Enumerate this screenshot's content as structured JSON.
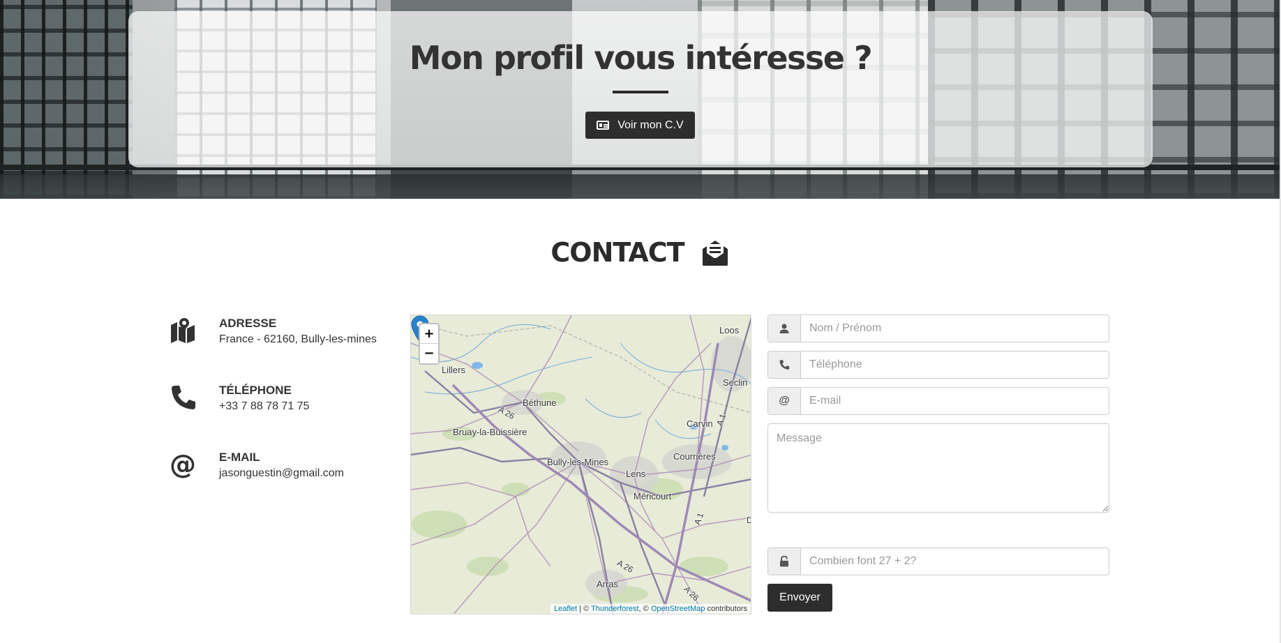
{
  "hero": {
    "title": "Mon profil vous intéresse ?",
    "cv_button_label": "Voir mon C.V",
    "cv_button_icon": "id-card-icon"
  },
  "contact": {
    "title": "CONTACT",
    "title_icon": "envelope-open-text-icon",
    "items": [
      {
        "icon": "map-icon",
        "label": "ADRESSE",
        "value": "France - 62160, Bully-les-mines"
      },
      {
        "icon": "phone-icon",
        "label": "TÉLÉPHONE",
        "value": "+33 7 88 78 71 75"
      },
      {
        "icon": "at-icon",
        "label": "E-MAIL",
        "value": "jasonguestin@gmail.com"
      }
    ]
  },
  "map": {
    "zoom_in": "+",
    "zoom_out": "−",
    "marker_label": "Bully-les-Mines",
    "labels": [
      "Loos",
      "Lillers",
      "Seclin",
      "Béthune",
      "Carvin",
      "Bruay-la-Buissière",
      "Courrières",
      "Lens",
      "Méricourt",
      "Arras",
      "D",
      "A 26",
      "A 1"
    ],
    "attribution": {
      "leaflet": "Leaflet",
      "sep1": " | © ",
      "thunderforest": "Thunderforest",
      "sep2": ", © ",
      "osm": "OpenStreetMap",
      "tail": " contributors"
    }
  },
  "form": {
    "name_placeholder": "Nom / Prénom",
    "phone_placeholder": "Téléphone",
    "email_addon": "@",
    "email_placeholder": "E-mail",
    "message_placeholder": "Message",
    "captcha_placeholder": "Combien font 27 + 2?",
    "submit_label": "Envoyer"
  },
  "colors": {
    "dark_button": "#2d2d2d",
    "text": "#333333",
    "link": "#0078a8",
    "marker": "#2a81cb"
  }
}
